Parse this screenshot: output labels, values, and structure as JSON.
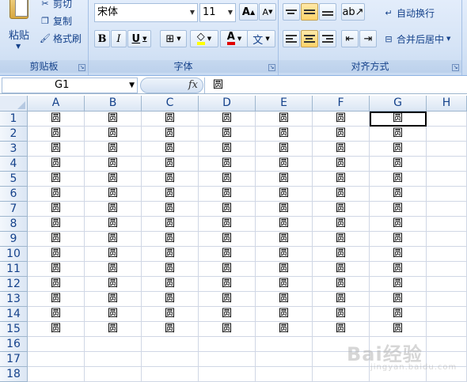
{
  "ribbon": {
    "clipboard": {
      "label": "剪贴板",
      "paste": "粘贴",
      "cut": "剪切",
      "copy": "复制",
      "format_painter": "格式刷"
    },
    "font": {
      "label": "字体",
      "font_name": "宋体",
      "font_size": "11",
      "grow": "A",
      "shrink": "A",
      "bold": "B",
      "italic": "I",
      "underline": "U",
      "font_color_glyph": "A",
      "phonetic_glyph": "文"
    },
    "alignment": {
      "label": "对齐方式",
      "wrap_text": "自动换行",
      "merge_center": "合并后居中"
    }
  },
  "formula_bar": {
    "name_box": "G1",
    "fx": "fx",
    "content": "圆"
  },
  "sheet": {
    "columns": [
      "A",
      "B",
      "C",
      "D",
      "E",
      "F",
      "G",
      "H"
    ],
    "rows": [
      "1",
      "2",
      "3",
      "4",
      "5",
      "6",
      "7",
      "8",
      "9",
      "10",
      "11",
      "12",
      "13",
      "14",
      "15",
      "16",
      "17",
      "18"
    ],
    "filled_rows": 15,
    "filled_cols": 7,
    "cell_value": "圆",
    "selected_cell": "G1"
  },
  "watermark": {
    "text": "Bai经验",
    "sub": "jingyan.baidu.com"
  },
  "colors": {
    "ribbon_bg": "#d6e4f6",
    "header_bg": "#dbe6f4",
    "grid_line": "#d0d7e5",
    "accent_text": "#15428b"
  }
}
